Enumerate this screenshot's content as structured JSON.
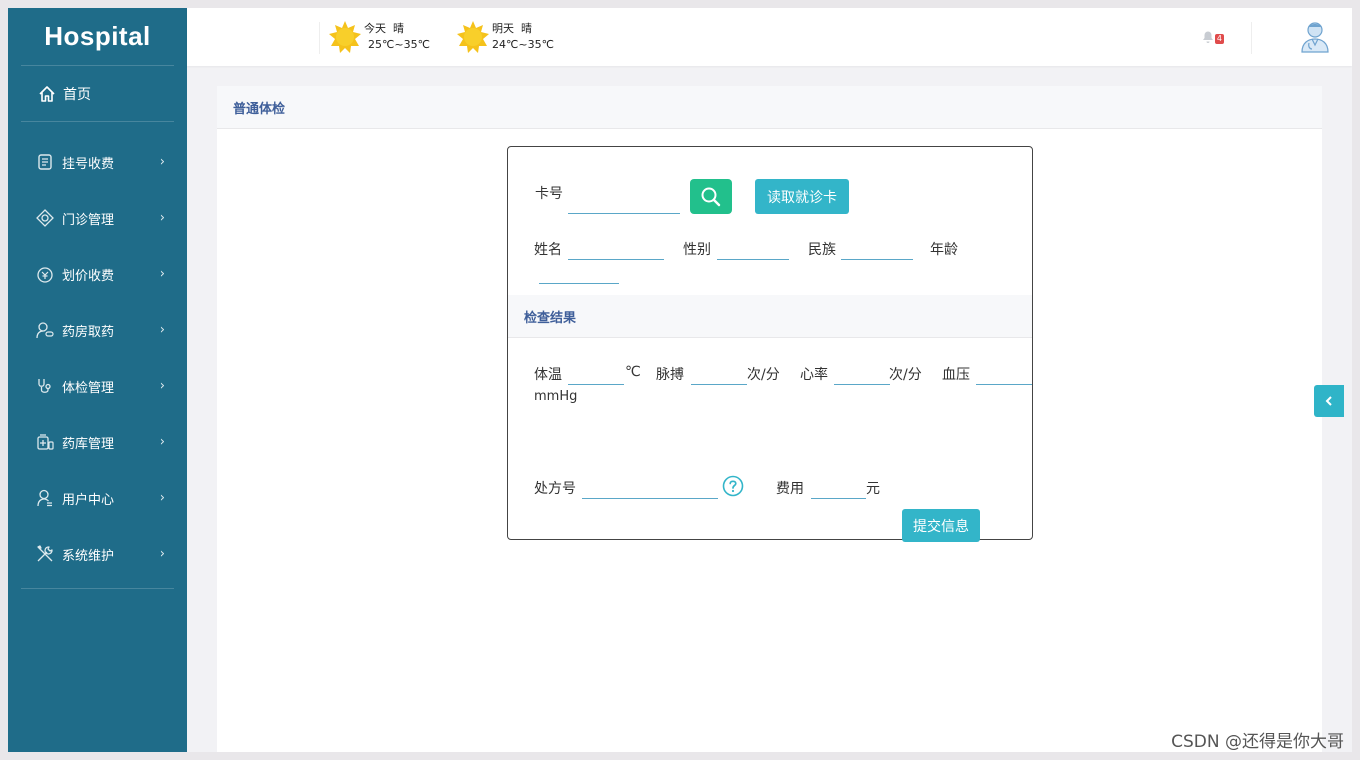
{
  "sidebar": {
    "brand": "Hospital",
    "home": {
      "label": "首页",
      "icon": "home-icon"
    },
    "items": [
      {
        "label": "挂号收费",
        "icon": "register-icon"
      },
      {
        "label": "门诊管理",
        "icon": "clinic-icon"
      },
      {
        "label": "划价收费",
        "icon": "pricing-icon"
      },
      {
        "label": "药房取药",
        "icon": "pharmacy-icon"
      },
      {
        "label": "体检管理",
        "icon": "stethoscope-icon"
      },
      {
        "label": "药库管理",
        "icon": "medicine-store-icon"
      },
      {
        "label": "用户中心",
        "icon": "user-icon"
      },
      {
        "label": "系统维护",
        "icon": "tools-icon"
      }
    ]
  },
  "header": {
    "weather": [
      {
        "day": "今天",
        "cond": "晴",
        "range": "25℃~35℃"
      },
      {
        "day": "明天",
        "cond": "晴",
        "range": "24℃~35℃"
      }
    ],
    "notification_count": "4"
  },
  "panel": {
    "title": "普通体检",
    "form": {
      "card_label": "卡号",
      "read_card_button": "读取就诊卡",
      "name_label": "姓名",
      "gender_label": "性别",
      "ethnicity_label": "民族",
      "age_label": "年龄",
      "section_title": "检查结果",
      "temp_label": "体温",
      "temp_unit": "℃",
      "pulse_label": "脉搏",
      "pulse_unit": "次/分",
      "heart_label": "心率",
      "heart_unit": "次/分",
      "bp_label": "血压",
      "bp_unit": "mmHg",
      "prescription_label": "处方号",
      "fee_label": "费用",
      "fee_unit": "元",
      "submit_button": "提交信息"
    }
  },
  "watermark": "CSDN @还得是你大哥",
  "colors": {
    "sidebar": "#1f6c89",
    "accent": "#33b5c9",
    "search_button": "#22c08c",
    "heading": "#3f5f9a"
  }
}
